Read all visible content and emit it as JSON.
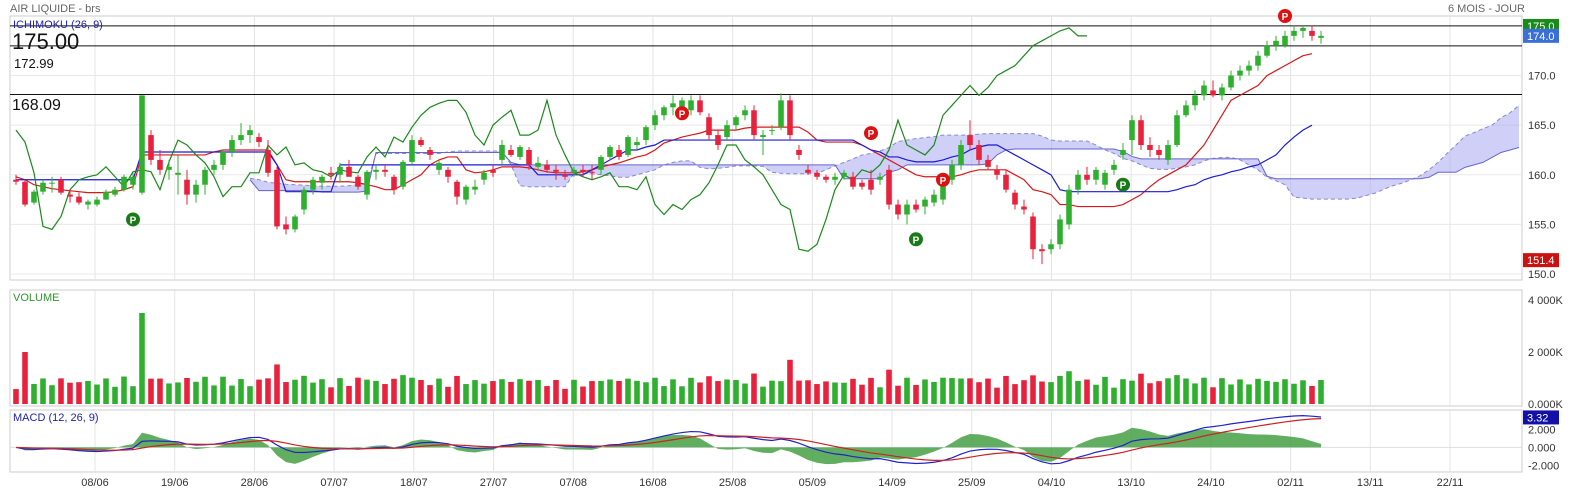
{
  "header": {
    "title": "AIR LIQUIDE - brs",
    "period": "6 MOIS - JOUR"
  },
  "main_panel": {
    "indicator_label": "ICHIMOKU (26, 9)",
    "price_display": "175.00",
    "levels": [
      {
        "label": "172.99",
        "value": 172.99
      },
      {
        "label": "168.09",
        "value": 168.09
      }
    ],
    "y_ticks": [
      "150.0",
      "155.0",
      "160.0",
      "165.0",
      "170.0"
    ],
    "badges": [
      {
        "label": "175.0",
        "value": 175.0,
        "color": "#1a8a1a"
      },
      {
        "label": "174.0",
        "value": 174.0,
        "color": "#3a6fd8"
      },
      {
        "label": "151.4",
        "value": 151.4,
        "color": "#cc1111"
      }
    ]
  },
  "volume_panel": {
    "label": "VOLUME",
    "y_ticks": [
      "0.000K",
      "2 000K",
      "4 000K"
    ]
  },
  "macd_panel": {
    "label": "MACD (12, 26, 9)",
    "y_ticks": [
      "-2.000",
      "0.000",
      "2.000"
    ],
    "badges": [
      {
        "label": "3.32",
        "value": 3.32,
        "color": "#1111aa"
      }
    ]
  },
  "x_axis": {
    "labels": [
      "08/06",
      "19/06",
      "28/06",
      "07/07",
      "18/07",
      "27/07",
      "07/08",
      "16/08",
      "25/08",
      "05/09",
      "14/09",
      "25/09",
      "04/10",
      "13/10",
      "24/10",
      "02/11",
      "13/11",
      "22/11"
    ]
  },
  "colors": {
    "up": "#2eb02e",
    "down": "#e8223c",
    "tenkan": "#d81818",
    "kijun": "#1a1ad8",
    "chikou": "#1a8a1a",
    "cloud": "#a8a8f0",
    "macd_hist": "#3a9a3a",
    "signal_p_up": "#1a7a1a",
    "signal_p_down": "#dd1111"
  },
  "chart_data": {
    "type": "candlestick",
    "title": "AIR LIQUIDE - brs",
    "subtitle": "6 MOIS - JOUR",
    "ylim": [
      149.5,
      176.0
    ],
    "candles": [
      {
        "o": 159.5,
        "h": 160.0,
        "l": 159.0,
        "c": 159.3
      },
      {
        "o": 159.3,
        "h": 159.5,
        "l": 156.8,
        "c": 157.0
      },
      {
        "o": 157.2,
        "h": 158.5,
        "l": 157.0,
        "c": 158.3
      },
      {
        "o": 158.3,
        "h": 159.5,
        "l": 158.0,
        "c": 159.2
      },
      {
        "o": 159.2,
        "h": 159.8,
        "l": 158.2,
        "c": 159.2
      },
      {
        "o": 159.5,
        "h": 159.8,
        "l": 158.0,
        "c": 158.2
      },
      {
        "o": 158.0,
        "h": 158.5,
        "l": 157.2,
        "c": 157.8
      },
      {
        "o": 157.8,
        "h": 158.2,
        "l": 157.0,
        "c": 157.2
      },
      {
        "o": 157.0,
        "h": 157.5,
        "l": 156.5,
        "c": 157.3
      },
      {
        "o": 157.0,
        "h": 157.8,
        "l": 156.8,
        "c": 157.5
      },
      {
        "o": 157.5,
        "h": 158.5,
        "l": 157.5,
        "c": 158.3
      },
      {
        "o": 158.0,
        "h": 158.8,
        "l": 157.8,
        "c": 158.5
      },
      {
        "o": 158.5,
        "h": 160.0,
        "l": 158.3,
        "c": 159.8
      },
      {
        "o": 159.0,
        "h": 160.2,
        "l": 158.5,
        "c": 159.8
      },
      {
        "o": 158.2,
        "h": 168.0,
        "l": 158.0,
        "c": 168.0
      },
      {
        "o": 164.0,
        "h": 164.5,
        "l": 161.0,
        "c": 161.5
      },
      {
        "o": 161.5,
        "h": 162.5,
        "l": 160.0,
        "c": 160.5
      },
      {
        "o": 160.5,
        "h": 161.5,
        "l": 159.5,
        "c": 160.8
      },
      {
        "o": 160.0,
        "h": 162.0,
        "l": 158.0,
        "c": 160.2
      },
      {
        "o": 159.5,
        "h": 160.5,
        "l": 157.0,
        "c": 158.0
      },
      {
        "o": 158.0,
        "h": 159.5,
        "l": 157.2,
        "c": 159.0
      },
      {
        "o": 159.0,
        "h": 160.8,
        "l": 158.0,
        "c": 160.5
      },
      {
        "o": 160.5,
        "h": 161.5,
        "l": 160.0,
        "c": 161.0
      },
      {
        "o": 161.0,
        "h": 162.5,
        "l": 160.5,
        "c": 162.3
      },
      {
        "o": 162.3,
        "h": 164.0,
        "l": 161.8,
        "c": 163.5
      },
      {
        "o": 163.5,
        "h": 165.2,
        "l": 163.0,
        "c": 164.0
      },
      {
        "o": 164.0,
        "h": 165.0,
        "l": 163.2,
        "c": 164.5
      },
      {
        "o": 163.8,
        "h": 164.2,
        "l": 162.8,
        "c": 163.3
      },
      {
        "o": 162.5,
        "h": 163.5,
        "l": 159.8,
        "c": 160.2
      },
      {
        "o": 160.5,
        "h": 160.8,
        "l": 154.5,
        "c": 154.8
      },
      {
        "o": 155.0,
        "h": 155.8,
        "l": 154.0,
        "c": 154.5
      },
      {
        "o": 154.5,
        "h": 156.0,
        "l": 154.2,
        "c": 155.8
      },
      {
        "o": 156.5,
        "h": 158.8,
        "l": 156.0,
        "c": 158.5
      },
      {
        "o": 158.5,
        "h": 159.8,
        "l": 158.0,
        "c": 159.5
      },
      {
        "o": 159.2,
        "h": 160.0,
        "l": 158.5,
        "c": 159.8
      },
      {
        "o": 160.2,
        "h": 160.8,
        "l": 159.5,
        "c": 160.0
      },
      {
        "o": 160.0,
        "h": 161.2,
        "l": 159.2,
        "c": 160.8
      },
      {
        "o": 160.8,
        "h": 161.5,
        "l": 159.8,
        "c": 159.8
      },
      {
        "o": 159.8,
        "h": 160.0,
        "l": 158.5,
        "c": 158.8
      },
      {
        "o": 158.0,
        "h": 160.5,
        "l": 157.5,
        "c": 160.3
      },
      {
        "o": 160.3,
        "h": 161.0,
        "l": 159.5,
        "c": 160.5
      },
      {
        "o": 160.5,
        "h": 161.0,
        "l": 159.8,
        "c": 160.3
      },
      {
        "o": 159.8,
        "h": 160.0,
        "l": 158.0,
        "c": 158.5
      },
      {
        "o": 158.8,
        "h": 161.5,
        "l": 158.5,
        "c": 161.3
      },
      {
        "o": 161.3,
        "h": 164.0,
        "l": 161.0,
        "c": 163.5
      },
      {
        "o": 163.5,
        "h": 163.8,
        "l": 162.8,
        "c": 163.0
      },
      {
        "o": 162.5,
        "h": 162.8,
        "l": 161.5,
        "c": 162.0
      },
      {
        "o": 160.5,
        "h": 161.5,
        "l": 160.0,
        "c": 161.2
      },
      {
        "o": 160.5,
        "h": 160.8,
        "l": 159.2,
        "c": 159.8
      },
      {
        "o": 159.3,
        "h": 159.5,
        "l": 157.0,
        "c": 157.8
      },
      {
        "o": 157.5,
        "h": 159.0,
        "l": 157.0,
        "c": 158.8
      },
      {
        "o": 158.5,
        "h": 159.5,
        "l": 158.0,
        "c": 158.8
      },
      {
        "o": 159.5,
        "h": 160.5,
        "l": 159.0,
        "c": 160.2
      },
      {
        "o": 160.5,
        "h": 161.0,
        "l": 159.8,
        "c": 160.2
      },
      {
        "o": 161.5,
        "h": 163.5,
        "l": 161.0,
        "c": 163.0
      },
      {
        "o": 162.5,
        "h": 163.0,
        "l": 161.8,
        "c": 162.0
      },
      {
        "o": 161.8,
        "h": 163.0,
        "l": 161.5,
        "c": 162.8
      },
      {
        "o": 162.5,
        "h": 162.8,
        "l": 160.5,
        "c": 161.0
      },
      {
        "o": 160.8,
        "h": 161.8,
        "l": 160.5,
        "c": 161.2
      },
      {
        "o": 161.0,
        "h": 161.5,
        "l": 160.2,
        "c": 160.5
      },
      {
        "o": 160.5,
        "h": 161.0,
        "l": 159.5,
        "c": 160.3
      },
      {
        "o": 160.0,
        "h": 160.5,
        "l": 159.5,
        "c": 159.8
      },
      {
        "o": 160.2,
        "h": 160.8,
        "l": 159.8,
        "c": 160.5
      },
      {
        "o": 160.5,
        "h": 161.0,
        "l": 159.8,
        "c": 160.3
      },
      {
        "o": 160.3,
        "h": 161.0,
        "l": 159.5,
        "c": 160.2
      },
      {
        "o": 160.5,
        "h": 162.0,
        "l": 160.0,
        "c": 161.8
      },
      {
        "o": 161.8,
        "h": 163.0,
        "l": 161.5,
        "c": 162.8
      },
      {
        "o": 162.5,
        "h": 163.0,
        "l": 161.5,
        "c": 161.8
      },
      {
        "o": 162.0,
        "h": 164.0,
        "l": 161.8,
        "c": 163.8
      },
      {
        "o": 163.0,
        "h": 163.8,
        "l": 162.5,
        "c": 163.3
      },
      {
        "o": 163.5,
        "h": 165.0,
        "l": 163.0,
        "c": 164.8
      },
      {
        "o": 165.0,
        "h": 166.5,
        "l": 164.5,
        "c": 166.0
      },
      {
        "o": 166.0,
        "h": 167.0,
        "l": 165.5,
        "c": 166.8
      },
      {
        "o": 166.8,
        "h": 168.0,
        "l": 166.0,
        "c": 167.2
      },
      {
        "o": 166.8,
        "h": 167.8,
        "l": 166.0,
        "c": 167.5
      },
      {
        "o": 166.5,
        "h": 168.0,
        "l": 166.0,
        "c": 167.5
      },
      {
        "o": 167.5,
        "h": 168.0,
        "l": 166.0,
        "c": 166.3
      },
      {
        "o": 165.8,
        "h": 166.2,
        "l": 163.5,
        "c": 164.0
      },
      {
        "o": 164.0,
        "h": 164.5,
        "l": 162.5,
        "c": 163.0
      },
      {
        "o": 163.8,
        "h": 165.5,
        "l": 163.5,
        "c": 165.0
      },
      {
        "o": 165.0,
        "h": 166.0,
        "l": 164.5,
        "c": 165.8
      },
      {
        "o": 166.0,
        "h": 167.0,
        "l": 165.5,
        "c": 166.5
      },
      {
        "o": 166.5,
        "h": 167.0,
        "l": 163.5,
        "c": 164.0
      },
      {
        "o": 163.8,
        "h": 164.5,
        "l": 162.0,
        "c": 164.0
      },
      {
        "o": 164.5,
        "h": 165.0,
        "l": 164.0,
        "c": 164.5
      },
      {
        "o": 164.8,
        "h": 168.2,
        "l": 164.5,
        "c": 167.5
      },
      {
        "o": 167.5,
        "h": 168.0,
        "l": 163.5,
        "c": 164.0
      },
      {
        "o": 162.5,
        "h": 163.0,
        "l": 161.5,
        "c": 162.0
      },
      {
        "o": 160.5,
        "h": 161.0,
        "l": 160.0,
        "c": 160.2
      },
      {
        "o": 160.2,
        "h": 160.5,
        "l": 159.5,
        "c": 159.8
      },
      {
        "o": 159.8,
        "h": 160.0,
        "l": 159.2,
        "c": 159.5
      },
      {
        "o": 159.5,
        "h": 160.2,
        "l": 159.0,
        "c": 159.8
      },
      {
        "o": 159.8,
        "h": 160.5,
        "l": 159.5,
        "c": 160.2
      },
      {
        "o": 159.8,
        "h": 160.3,
        "l": 158.5,
        "c": 158.8
      },
      {
        "o": 159.2,
        "h": 159.5,
        "l": 158.5,
        "c": 158.8
      },
      {
        "o": 159.5,
        "h": 160.5,
        "l": 158.0,
        "c": 158.5
      },
      {
        "o": 159.5,
        "h": 160.2,
        "l": 159.0,
        "c": 159.8
      },
      {
        "o": 160.5,
        "h": 161.0,
        "l": 156.5,
        "c": 157.0
      },
      {
        "o": 157.0,
        "h": 157.5,
        "l": 155.5,
        "c": 156.0
      },
      {
        "o": 156.0,
        "h": 157.5,
        "l": 155.0,
        "c": 157.0
      },
      {
        "o": 157.0,
        "h": 157.5,
        "l": 156.2,
        "c": 156.5
      },
      {
        "o": 156.8,
        "h": 157.8,
        "l": 156.0,
        "c": 157.5
      },
      {
        "o": 157.2,
        "h": 158.5,
        "l": 156.8,
        "c": 158.0
      },
      {
        "o": 157.5,
        "h": 159.5,
        "l": 157.0,
        "c": 159.2
      },
      {
        "o": 159.5,
        "h": 161.5,
        "l": 159.0,
        "c": 161.0
      },
      {
        "o": 161.0,
        "h": 163.5,
        "l": 160.5,
        "c": 163.0
      },
      {
        "o": 164.0,
        "h": 165.5,
        "l": 162.5,
        "c": 163.0
      },
      {
        "o": 163.0,
        "h": 163.5,
        "l": 161.0,
        "c": 161.5
      },
      {
        "o": 161.5,
        "h": 162.0,
        "l": 160.5,
        "c": 160.8
      },
      {
        "o": 160.5,
        "h": 161.0,
        "l": 159.5,
        "c": 160.0
      },
      {
        "o": 160.0,
        "h": 160.5,
        "l": 158.2,
        "c": 158.5
      },
      {
        "o": 158.2,
        "h": 158.5,
        "l": 156.5,
        "c": 157.0
      },
      {
        "o": 156.8,
        "h": 157.5,
        "l": 156.0,
        "c": 156.5
      },
      {
        "o": 155.8,
        "h": 156.2,
        "l": 151.5,
        "c": 152.5
      },
      {
        "o": 152.5,
        "h": 153.0,
        "l": 151.0,
        "c": 152.3
      },
      {
        "o": 152.5,
        "h": 153.5,
        "l": 152.0,
        "c": 153.0
      },
      {
        "o": 153.0,
        "h": 156.0,
        "l": 152.5,
        "c": 155.5
      },
      {
        "o": 155.0,
        "h": 159.0,
        "l": 154.5,
        "c": 158.5
      },
      {
        "o": 158.5,
        "h": 160.5,
        "l": 158.0,
        "c": 160.0
      },
      {
        "o": 160.0,
        "h": 160.8,
        "l": 159.0,
        "c": 159.5
      },
      {
        "o": 159.5,
        "h": 160.8,
        "l": 159.0,
        "c": 160.5
      },
      {
        "o": 159.0,
        "h": 160.5,
        "l": 158.5,
        "c": 160.2
      },
      {
        "o": 160.5,
        "h": 161.5,
        "l": 160.0,
        "c": 161.0
      },
      {
        "o": 162.0,
        "h": 163.2,
        "l": 161.5,
        "c": 162.5
      },
      {
        "o": 163.5,
        "h": 166.0,
        "l": 162.0,
        "c": 165.5
      },
      {
        "o": 165.5,
        "h": 166.0,
        "l": 162.5,
        "c": 163.0
      },
      {
        "o": 163.0,
        "h": 163.8,
        "l": 161.8,
        "c": 162.5
      },
      {
        "o": 162.5,
        "h": 163.0,
        "l": 161.5,
        "c": 162.0
      },
      {
        "o": 161.5,
        "h": 163.5,
        "l": 161.0,
        "c": 163.0
      },
      {
        "o": 163.0,
        "h": 166.5,
        "l": 162.8,
        "c": 166.0
      },
      {
        "o": 166.0,
        "h": 167.5,
        "l": 165.8,
        "c": 167.0
      },
      {
        "o": 167.0,
        "h": 168.5,
        "l": 166.5,
        "c": 168.0
      },
      {
        "o": 168.0,
        "h": 169.5,
        "l": 167.5,
        "c": 169.0
      },
      {
        "o": 168.5,
        "h": 169.5,
        "l": 167.8,
        "c": 168.0
      },
      {
        "o": 168.0,
        "h": 169.2,
        "l": 167.5,
        "c": 168.8
      },
      {
        "o": 168.8,
        "h": 170.5,
        "l": 168.5,
        "c": 170.0
      },
      {
        "o": 170.0,
        "h": 171.0,
        "l": 169.5,
        "c": 170.5
      },
      {
        "o": 170.5,
        "h": 171.5,
        "l": 170.0,
        "c": 171.0
      },
      {
        "o": 171.0,
        "h": 172.5,
        "l": 170.5,
        "c": 172.0
      },
      {
        "o": 172.0,
        "h": 173.5,
        "l": 171.8,
        "c": 173.0
      },
      {
        "o": 173.0,
        "h": 174.0,
        "l": 172.5,
        "c": 173.5
      },
      {
        "o": 173.0,
        "h": 174.5,
        "l": 172.8,
        "c": 174.0
      },
      {
        "o": 174.0,
        "h": 175.0,
        "l": 173.5,
        "c": 174.5
      },
      {
        "o": 174.5,
        "h": 175.0,
        "l": 173.8,
        "c": 174.8
      },
      {
        "o": 174.5,
        "h": 175.0,
        "l": 173.5,
        "c": 174.0
      },
      {
        "o": 173.8,
        "h": 174.5,
        "l": 173.2,
        "c": 174.0
      }
    ],
    "tenkan": [
      159.8,
      159.5,
      159.0,
      158.8,
      158.6,
      158.5,
      158.4,
      158.3,
      158.2,
      158.2,
      158.2,
      158.3,
      158.5,
      158.8,
      162.0,
      162.0,
      162.0,
      162.0,
      162.0,
      162.0,
      162.0,
      162.0,
      162.3,
      162.5,
      162.5,
      162.5,
      162.5,
      162.5,
      162.5,
      161.0,
      159.5,
      159.3,
      159.3,
      159.3,
      159.3,
      159.3,
      159.3,
      159.3,
      159.2,
      159.0,
      158.8,
      158.5,
      158.5,
      159.0,
      159.5,
      160.0,
      161.0,
      161.5,
      161.8,
      161.8,
      160.5,
      160.2,
      160.3,
      160.5,
      160.8,
      160.8,
      160.8,
      160.7,
      160.5,
      160.3,
      160.2,
      160.2,
      160.2,
      160.3,
      160.5,
      160.8,
      161.0,
      161.2,
      161.5,
      161.8,
      162.0,
      162.5,
      163.2,
      163.5,
      163.8,
      164.0,
      164.2,
      164.5,
      164.5,
      164.5,
      164.5,
      164.7,
      164.8,
      164.8,
      164.8,
      164.8,
      164.8,
      164.8,
      164.3,
      163.5,
      163.3,
      163.3,
      163.3,
      163.3,
      163.0,
      162.5,
      162.0,
      161.5,
      161.0,
      160.5,
      160.0,
      159.8,
      159.8,
      159.8,
      159.8,
      160.0,
      160.3,
      160.5,
      160.5,
      160.5,
      160.5,
      160.0,
      159.5,
      158.5,
      158.3,
      158.0,
      157.0,
      157.0,
      156.8,
      156.8,
      156.8,
      156.8,
      156.8,
      157.0,
      157.5,
      158.0,
      158.8,
      159.5,
      160.0,
      160.5,
      161.0,
      162.0,
      163.0,
      164.5,
      166.0,
      167.5,
      168.0,
      168.5,
      169.0,
      170.0,
      170.5,
      171.0,
      171.5,
      172.0,
      172.2
    ],
    "kijun": [
      159.5,
      159.5,
      159.5,
      159.5,
      159.5,
      159.5,
      159.5,
      159.5,
      159.5,
      159.5,
      159.5,
      159.5,
      159.5,
      159.5,
      162.3,
      162.3,
      162.3,
      162.3,
      162.3,
      162.3,
      162.3,
      162.3,
      162.3,
      162.3,
      162.3,
      162.3,
      162.3,
      162.3,
      162.3,
      161.0,
      158.3,
      158.3,
      158.3,
      158.3,
      158.3,
      158.3,
      161.0,
      161.0,
      161.0,
      161.0,
      161.0,
      161.0,
      161.0,
      161.0,
      161.0,
      161.0,
      161.0,
      161.0,
      161.0,
      161.0,
      161.0,
      161.0,
      161.0,
      161.0,
      161.0,
      161.0,
      161.0,
      161.0,
      160.0,
      160.0,
      160.0,
      160.0,
      160.0,
      160.0,
      160.5,
      161.0,
      161.5,
      162.0,
      162.5,
      162.5,
      162.8,
      163.0,
      163.5,
      163.5,
      163.5,
      163.5,
      163.5,
      163.5,
      163.5,
      163.5,
      163.5,
      163.5,
      163.5,
      163.5,
      163.5,
      163.5,
      163.5,
      163.5,
      163.5,
      163.5,
      163.5,
      163.5,
      163.5,
      163.5,
      163.0,
      162.5,
      162.3,
      161.8,
      161.8,
      161.5,
      161.3,
      161.3,
      161.3,
      161.5,
      161.8,
      162.0,
      162.5,
      162.8,
      163.0,
      163.0,
      162.5,
      162.0,
      161.5,
      161.0,
      160.5,
      160.0,
      158.5,
      158.3,
      158.3,
      158.3,
      158.3,
      158.3,
      158.3,
      158.3,
      158.3,
      158.3,
      158.3,
      158.3,
      158.3,
      158.5,
      158.8,
      159.0,
      159.5,
      159.8,
      160.0,
      160.3,
      160.5,
      160.8,
      161.0,
      161.5,
      162.0,
      163.0,
      163.8,
      164.5,
      165.0
    ]
  }
}
